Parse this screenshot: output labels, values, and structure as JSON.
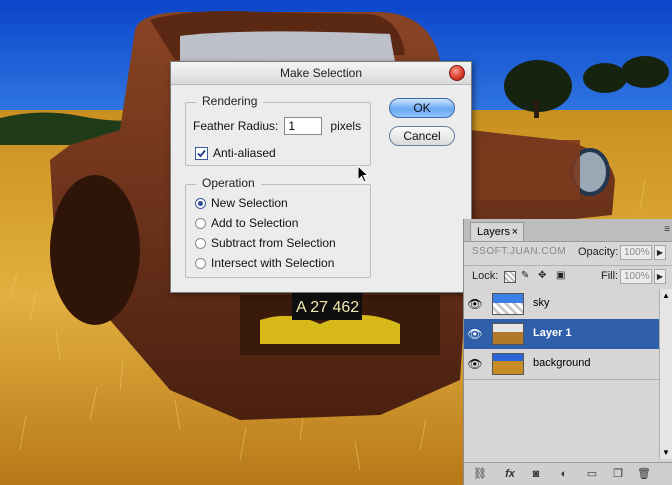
{
  "dialog": {
    "title": "Make Selection",
    "rendering_label": "Rendering",
    "feather_label": "Feather Radius:",
    "feather_value": "1",
    "feather_unit": "pixels",
    "antialiased_label": "Anti-aliased",
    "antialiased_checked": true,
    "operation_label": "Operation",
    "options": [
      "New Selection",
      "Add to Selection",
      "Subtract from Selection",
      "Intersect with Selection"
    ],
    "selected_option": "New Selection",
    "ok_label": "OK",
    "cancel_label": "Cancel"
  },
  "background": {
    "license_plate": "A 27 462"
  },
  "layers_panel": {
    "tab_label": "Layers",
    "tab_close": "×",
    "menu_icon": "≡",
    "opacity_label": "Opacity:",
    "opacity_value": "100%",
    "watermark": "SSOFT.JUAN.COM",
    "lock_label": "Lock:",
    "fill_label": "Fill:",
    "fill_value": "100%",
    "layers": [
      {
        "name": "sky",
        "selected": false
      },
      {
        "name": "Layer 1",
        "selected": true
      },
      {
        "name": "background",
        "selected": false
      }
    ],
    "bottom_icons": [
      "link-layers-icon",
      "fx-icon",
      "mask-icon",
      "adjustment-icon",
      "group-icon",
      "new-layer-icon",
      "trash-icon"
    ],
    "fx_label": "fx"
  },
  "colors": {
    "sky": "#1e63d6",
    "grass": "#d8a32a",
    "truck": "#7a3a1e",
    "selected_layer": "#2f5fa9"
  }
}
